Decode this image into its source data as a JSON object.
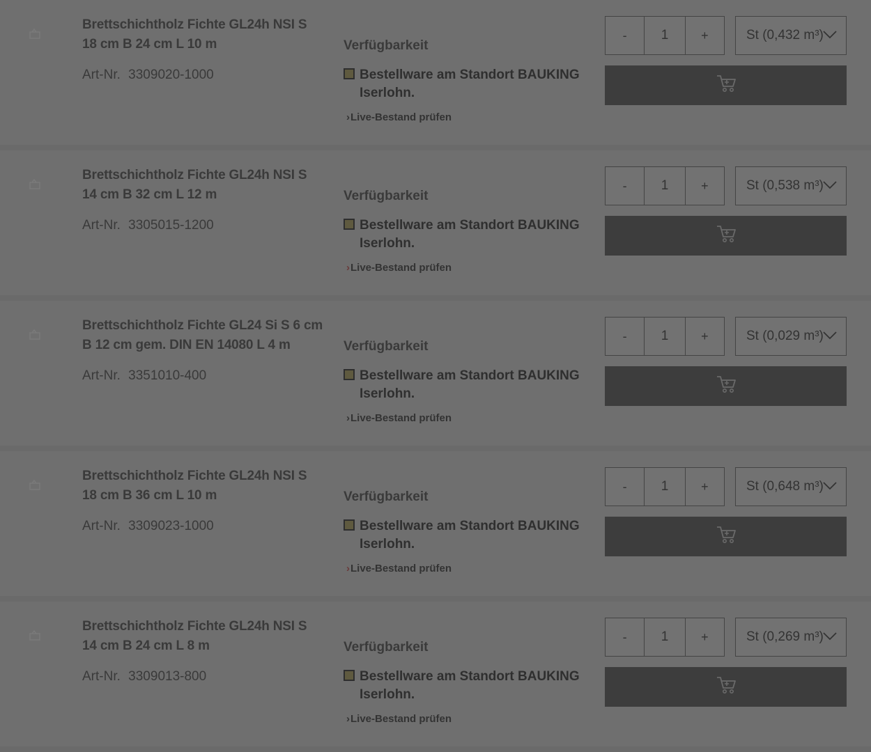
{
  "colors": {
    "overlay_bg": "#6f6f6f",
    "cart_button": "#3d3d3d",
    "availability_square": "#5f5a3f"
  },
  "products": [
    {
      "title_line1": "Brettschichtholz Fichte GL24h NSI S",
      "title_line2": "18 cm B 24 cm L 10 m",
      "artnr_label": "Art-Nr.",
      "artnr": "3309020-1000",
      "availability_heading": "Verfügbarkeit",
      "availability_text": "Bestellware am Standort BAUKING Iserlohn.",
      "live_link": "Live-Bestand prüfen",
      "qty_minus": "-",
      "qty": "1",
      "qty_plus": "+",
      "unit": "St (0,432 m³)",
      "chevron_red": false
    },
    {
      "title_line1": "Brettschichtholz Fichte GL24h NSI S",
      "title_line2": "14 cm B 32 cm L 12 m",
      "artnr_label": "Art-Nr.",
      "artnr": "3305015-1200",
      "availability_heading": "Verfügbarkeit",
      "availability_text": "Bestellware am Standort BAUKING Iserlohn.",
      "live_link": "Live-Bestand prüfen",
      "qty_minus": "-",
      "qty": "1",
      "qty_plus": "+",
      "unit": "St (0,538 m³)",
      "chevron_red": true
    },
    {
      "title_line1": "Brettschichtholz Fichte GL24 Si S 6 cm",
      "title_line2": "B 12 cm gem. DIN EN 14080 L 4 m",
      "artnr_label": "Art-Nr.",
      "artnr": "3351010-400",
      "availability_heading": "Verfügbarkeit",
      "availability_text": "Bestellware am Standort BAUKING Iserlohn.",
      "live_link": "Live-Bestand prüfen",
      "qty_minus": "-",
      "qty": "1",
      "qty_plus": "+",
      "unit": "St (0,029 m³)",
      "chevron_red": false
    },
    {
      "title_line1": "Brettschichtholz Fichte GL24h NSI S",
      "title_line2": "18 cm B 36 cm L 10 m",
      "artnr_label": "Art-Nr.",
      "artnr": "3309023-1000",
      "availability_heading": "Verfügbarkeit",
      "availability_text": "Bestellware am Standort BAUKING Iserlohn.",
      "live_link": "Live-Bestand prüfen",
      "qty_minus": "-",
      "qty": "1",
      "qty_plus": "+",
      "unit": "St (0,648 m³)",
      "chevron_red": true
    },
    {
      "title_line1": "Brettschichtholz Fichte GL24h NSI S",
      "title_line2": "14 cm B 24 cm L 8 m",
      "artnr_label": "Art-Nr.",
      "artnr": "3309013-800",
      "availability_heading": "Verfügbarkeit",
      "availability_text": "Bestellware am Standort BAUKING Iserlohn.",
      "live_link": "Live-Bestand prüfen",
      "qty_minus": "-",
      "qty": "1",
      "qty_plus": "+",
      "unit": "St (0,269 m³)",
      "chevron_red": false
    }
  ]
}
